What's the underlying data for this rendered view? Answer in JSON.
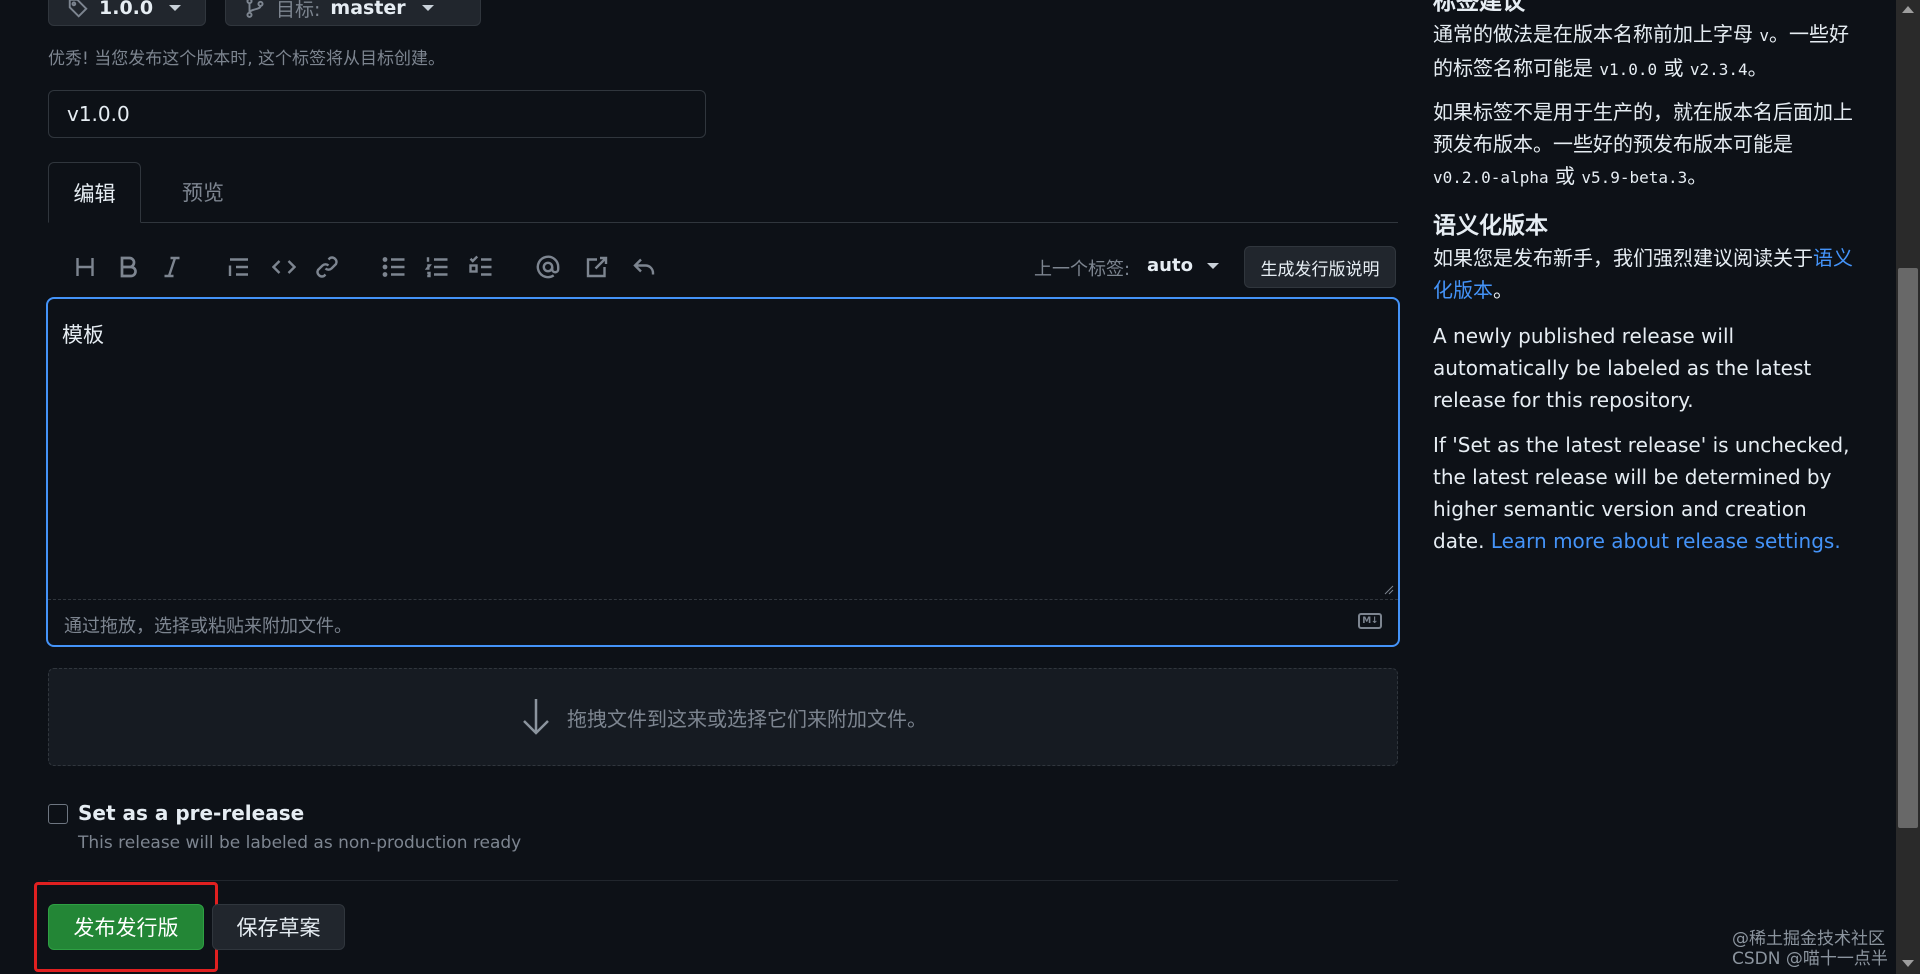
{
  "top_bar": {
    "tag_value": "1.0.0",
    "target_label": "目标:",
    "target_value": "master"
  },
  "hint": "优秀! 当您发布这个版本时, 这个标签将从目标创建。",
  "release_title": {
    "value": "v1.0.0"
  },
  "tabs": [
    {
      "label": "编辑"
    },
    {
      "label": "预览"
    }
  ],
  "toolbar": {
    "prev_tag_label": "上一个标签:",
    "prev_tag_value": "auto",
    "generate_notes_label": "生成发行版说明"
  },
  "editor": {
    "content": "模板",
    "attach_hint": "通过拖放，选择或粘贴来附加文件。",
    "md_badge": "M↓"
  },
  "drop_zone": {
    "text": "拖拽文件到这来或选择它们来附加文件。"
  },
  "prerelease": {
    "label": "Set as a pre-release",
    "description": "This release will be labeled as non-production ready"
  },
  "actions": {
    "publish_label": "发布发行版",
    "draft_label": "保存草案"
  },
  "sidebar": {
    "section1_title": "标签建议",
    "p1_a": "通常的做法是在版本名称前加上字母 ",
    "p1_code1": "v",
    "p1_b": "。一些好的标签名称可能是 ",
    "p1_code2": "v1.0.0",
    "p1_c": " 或 ",
    "p1_code3": "v2.3.4",
    "p1_d": "。",
    "p2_a": "如果标签不是用于生产的，就在版本名后面加上预发布版本。一些好的预发布版本可能是 ",
    "p2_code1": "v0.2.0-alpha",
    "p2_b": " 或 ",
    "p2_code2": "v5.9-beta.3",
    "p2_c": "。",
    "section2_title": "语义化版本",
    "p3_a": "如果您是发布新手，我们强烈建议阅读关于",
    "p3_link": "语义化版本",
    "p3_b": "。",
    "p4": "A newly published release will automatically be labeled as the latest release for this repository.",
    "p5_a": "If 'Set as the latest release' is unchecked, the latest release will be determined by higher semantic version and creation date. ",
    "p5_link": "Learn more about release settings."
  },
  "watermark": {
    "line1": "@稀土掘金技术社区",
    "line2": "CSDN @喵十一点半"
  }
}
